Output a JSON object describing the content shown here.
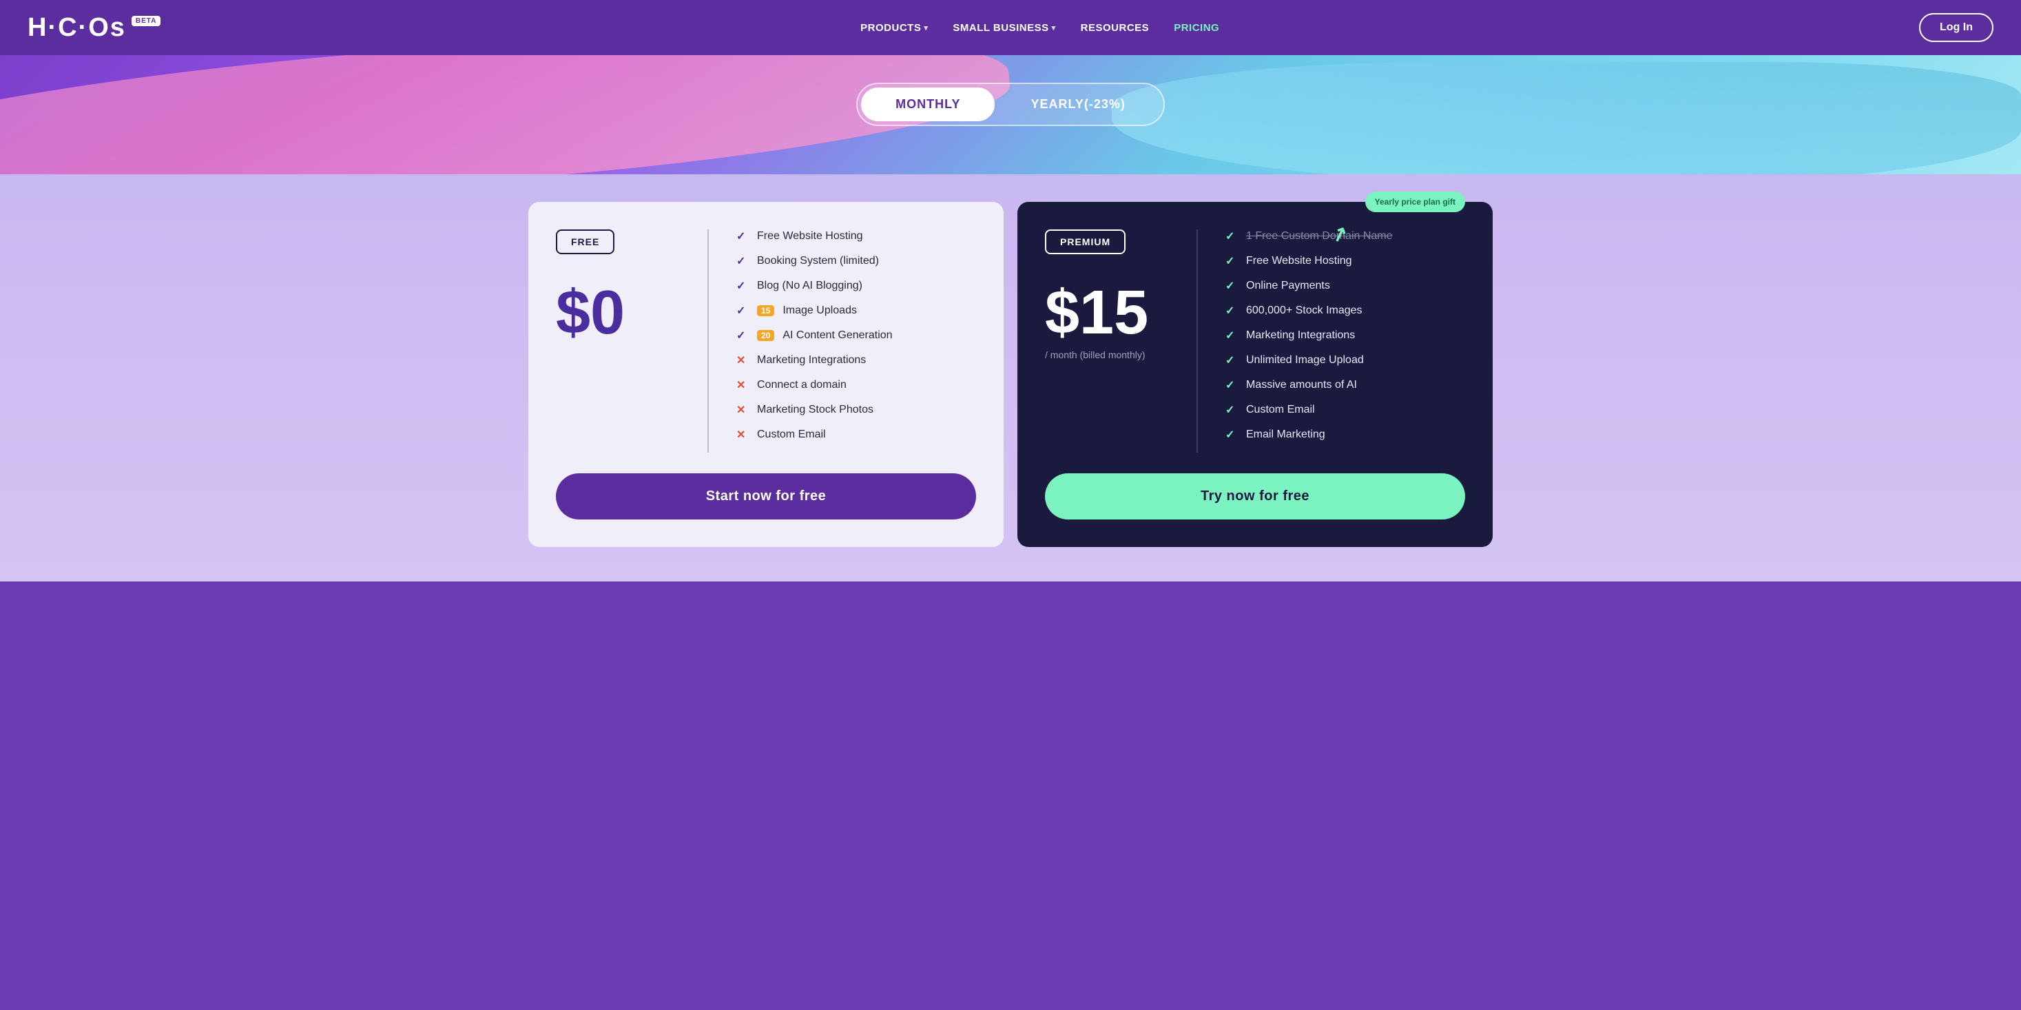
{
  "header": {
    "logo": "H·C·Os",
    "beta": "BETA",
    "nav": {
      "products": "PRODUCTS",
      "small_business": "SMALL BUSINESS",
      "resources": "RESOURCES",
      "pricing": "PRICING"
    },
    "login_label": "Log In"
  },
  "toggle": {
    "monthly_label": "MONTHLY",
    "yearly_label": "YEARLY(-23%)"
  },
  "free_plan": {
    "badge": "FREE",
    "price": "$0",
    "features": [
      {
        "icon": "check",
        "text": "Free Website Hosting",
        "strikethrough": false
      },
      {
        "icon": "check",
        "text": "Booking System (limited)",
        "strikethrough": false
      },
      {
        "icon": "check",
        "text": "Blog (No AI Blogging)",
        "strikethrough": false
      },
      {
        "icon": "check",
        "text": "Image Uploads",
        "strikethrough": false,
        "limit": "15"
      },
      {
        "icon": "check",
        "text": "AI Content Generation",
        "strikethrough": false,
        "limit": "20"
      },
      {
        "icon": "x",
        "text": "Marketing Integrations",
        "strikethrough": false
      },
      {
        "icon": "x",
        "text": "Connect a domain",
        "strikethrough": false
      },
      {
        "icon": "x",
        "text": "Marketing Stock Photos",
        "strikethrough": false
      },
      {
        "icon": "x",
        "text": "Custom Email",
        "strikethrough": false
      }
    ],
    "cta": "Start now for free"
  },
  "premium_plan": {
    "badge": "PREMIUM",
    "price": "$15",
    "price_subtitle": "/ month (billed monthly)",
    "gift_badge": "Yearly price plan gift",
    "features": [
      {
        "icon": "check",
        "text": "1 Free Custom Domain Name",
        "strikethrough": true
      },
      {
        "icon": "check",
        "text": "Free Website Hosting",
        "strikethrough": false
      },
      {
        "icon": "check",
        "text": "Online Payments",
        "strikethrough": false
      },
      {
        "icon": "check",
        "text": "600,000+ Stock Images",
        "strikethrough": false
      },
      {
        "icon": "check",
        "text": "Marketing Integrations",
        "strikethrough": false
      },
      {
        "icon": "check",
        "text": "Unlimited Image Upload",
        "strikethrough": false
      },
      {
        "icon": "check",
        "text": "Massive amounts of AI",
        "strikethrough": false
      },
      {
        "icon": "check",
        "text": "Custom Email",
        "strikethrough": false
      },
      {
        "icon": "check",
        "text": "Email Marketing",
        "strikethrough": false
      }
    ],
    "cta": "Try now for free"
  }
}
